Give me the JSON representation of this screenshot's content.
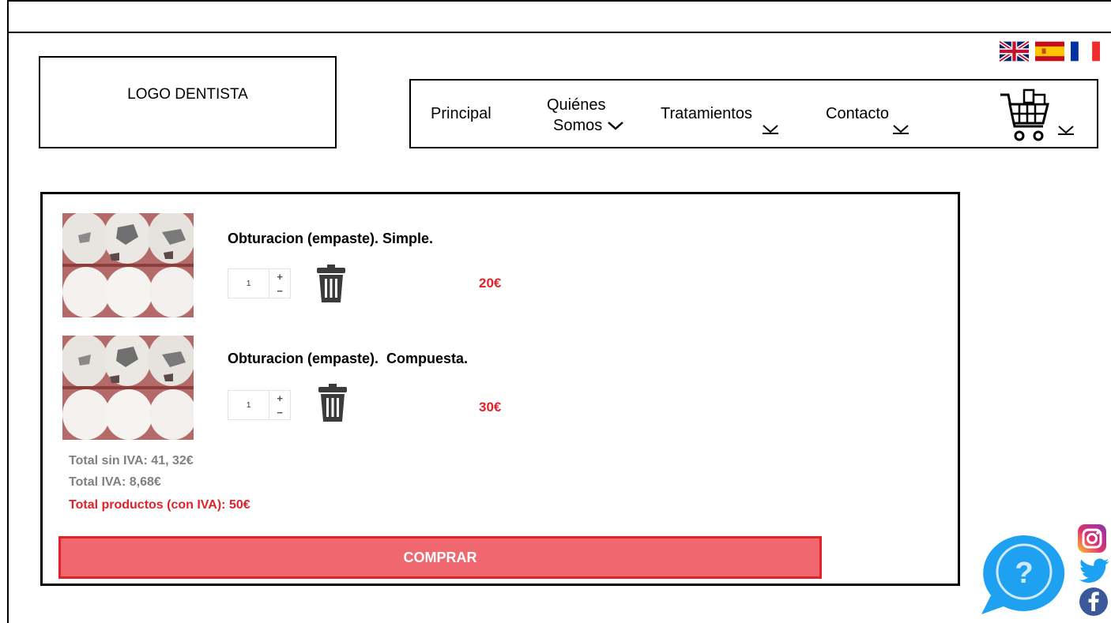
{
  "header": {
    "logo_text": "LOGO DENTISTA",
    "languages": [
      {
        "icon": "uk-flag-icon"
      },
      {
        "icon": "spain-flag-icon"
      },
      {
        "icon": "france-flag-icon"
      }
    ]
  },
  "nav": {
    "items": [
      {
        "label": "Principal"
      },
      {
        "label_line1": "Quiénes",
        "label_line2": "Somos"
      },
      {
        "label": "Tratamientos"
      },
      {
        "label": "Contacto"
      }
    ],
    "cart_icon": "shopping-cart-icon"
  },
  "cart": {
    "items": [
      {
        "name": "Obturacion (empaste). Simple.",
        "quantity": "1",
        "price": "20€"
      },
      {
        "name": "Obturacion (empaste).  Compuesta.",
        "quantity": "1",
        "price": "30€"
      }
    ],
    "total_sin_iva": "Total sin IVA: 41, 32€",
    "total_iva": "Total IVA: 8,68€",
    "total_productos": "Total productos (con IVA): 50€",
    "buy_label": "COMPRAR"
  },
  "help": {
    "symbol": "?"
  },
  "social": [
    "instagram-icon",
    "twitter-icon",
    "facebook-icon"
  ],
  "colors": {
    "accent_red": "#e3212a",
    "buy_fill": "#f0676f",
    "help_blue": "#1ea1f1"
  }
}
